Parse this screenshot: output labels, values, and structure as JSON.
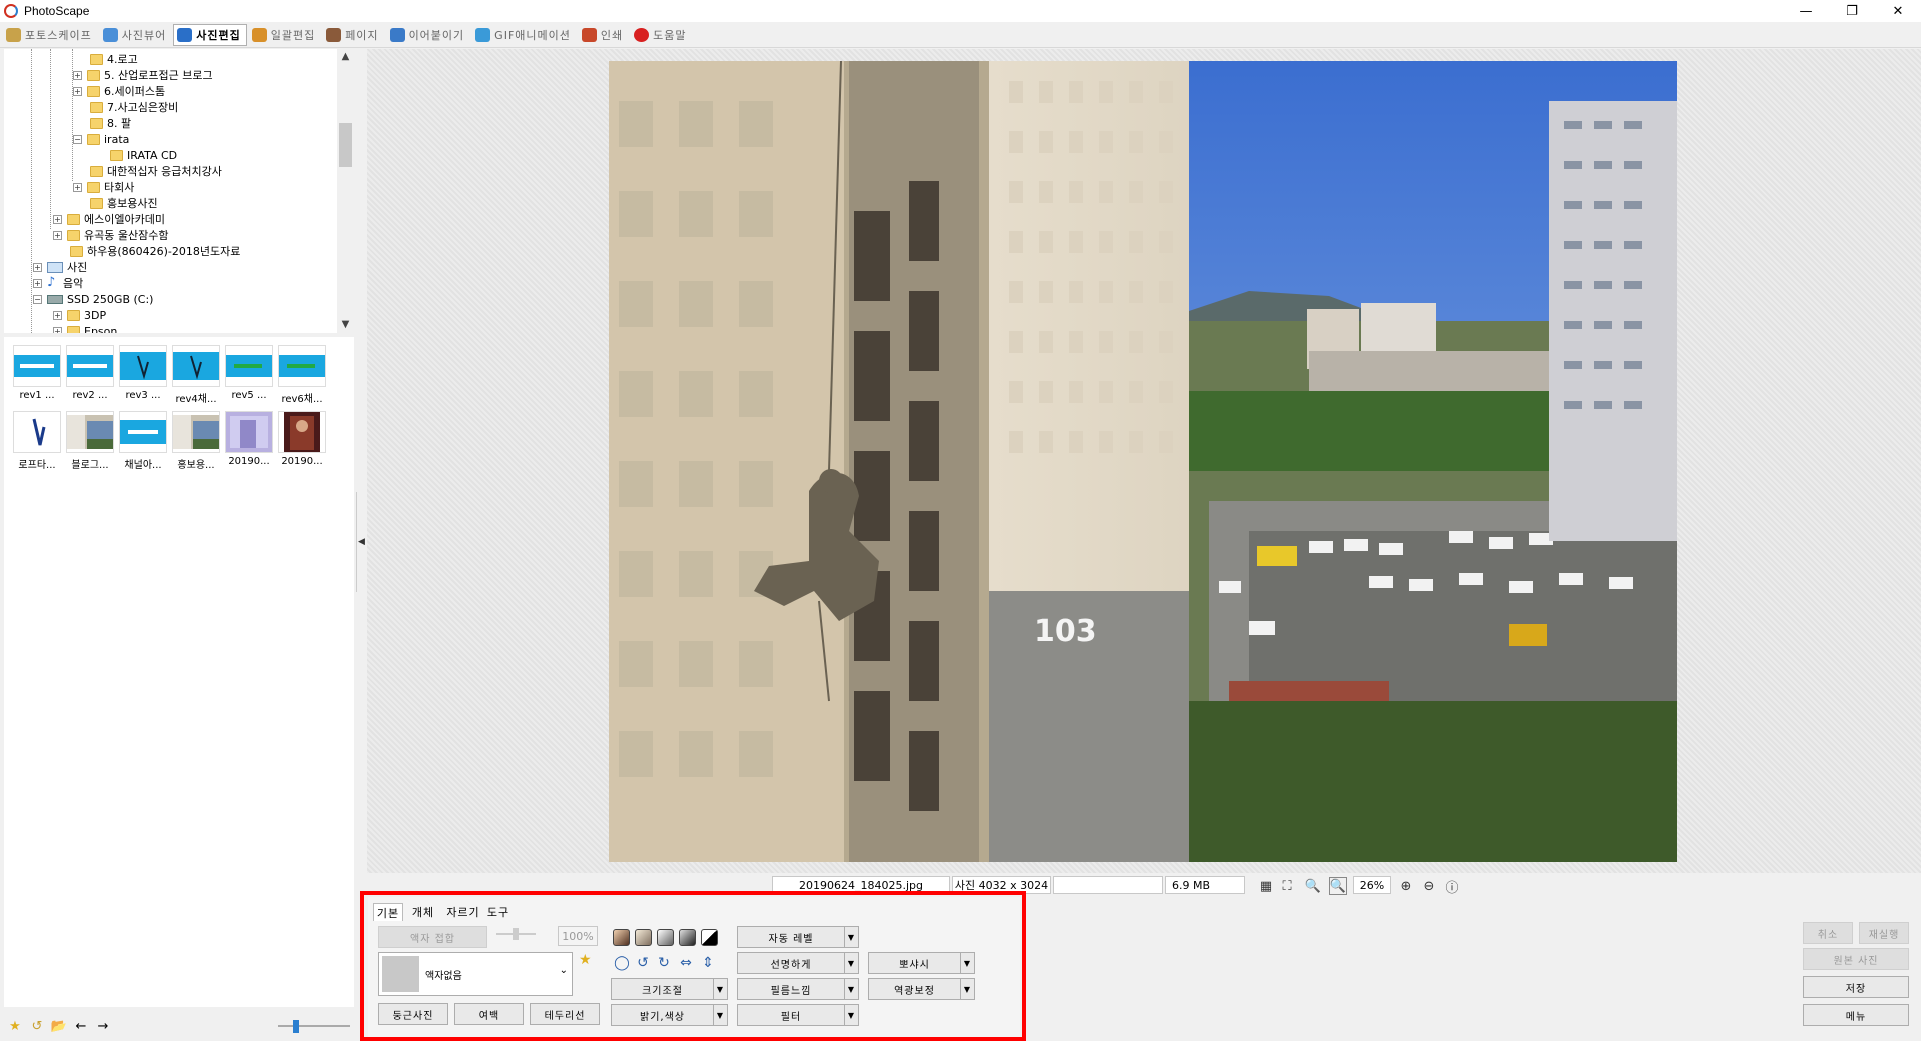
{
  "window": {
    "title": "PhotoScape"
  },
  "main_tabs": [
    {
      "label": "포토스케이프",
      "color": "#c8a24a"
    },
    {
      "label": "사진뷰어",
      "color": "#4a8fd8"
    },
    {
      "label": "사진편집",
      "color": "#2a6fc8"
    },
    {
      "label": "일괄편집",
      "color": "#d8902a"
    },
    {
      "label": "페이지",
      "color": "#8a5a3a"
    },
    {
      "label": "이어붙이기",
      "color": "#3a7ac8"
    },
    {
      "label": "GIF애니메이션",
      "color": "#3a9ad8"
    },
    {
      "label": "인쇄",
      "color": "#c8482a"
    },
    {
      "label": "도움말",
      "color": "#d82020"
    }
  ],
  "tree": [
    "4.로고",
    "5. 산업로프접근 브로그",
    "6.세이퍼스톰",
    "7.사고심은장비",
    "8. 팔",
    "irata",
    "IRATA CD",
    "대한적십자 응급처치강사",
    "타회사",
    "홍보용사진",
    "에스이엘아카데미",
    "유곡동 울산잠수함",
    "하우용(860426)-2018년도자료",
    "사진",
    "음악",
    "SSD 250GB (C:)",
    "3DP",
    "Epson"
  ],
  "thumbnails": [
    {
      "caption": "rev1 ..."
    },
    {
      "caption": "rev2 ..."
    },
    {
      "caption": "rev3 ..."
    },
    {
      "caption": "rev4채..."
    },
    {
      "caption": "rev5 ..."
    },
    {
      "caption": "rev6채..."
    },
    {
      "caption": "로프타..."
    },
    {
      "caption": "블로그..."
    },
    {
      "caption": "채널아..."
    },
    {
      "caption": "홍보용..."
    },
    {
      "caption": "20190..."
    },
    {
      "caption": "20190..."
    }
  ],
  "photo": {
    "building_number": "103"
  },
  "status": {
    "filename": "20190624_184025.jpg",
    "dimensions": "사진 4032 x 3024",
    "filesize": "6.9 MB",
    "zoom": "26%"
  },
  "edit": {
    "subtabs": [
      "기본",
      "개체",
      "자르기",
      "도구"
    ],
    "frame_attach": "액자 접합",
    "percent": "100%",
    "frame_select": "액자없음",
    "round_photo": "둥근사진",
    "margin": "여백",
    "border": "테두리선",
    "resize": "크기조절",
    "brightness": "밝기,색상",
    "auto_level": "자동 레벨",
    "sharpen": "선명하게",
    "film": "필름느낌",
    "filter": "필터",
    "bloom": "뽀샤시",
    "backlight": "역광보정"
  },
  "right_buttons": {
    "undo": "취소",
    "redo": "재실행",
    "original": "원본 사진",
    "save": "저장",
    "menu": "메뉴"
  }
}
